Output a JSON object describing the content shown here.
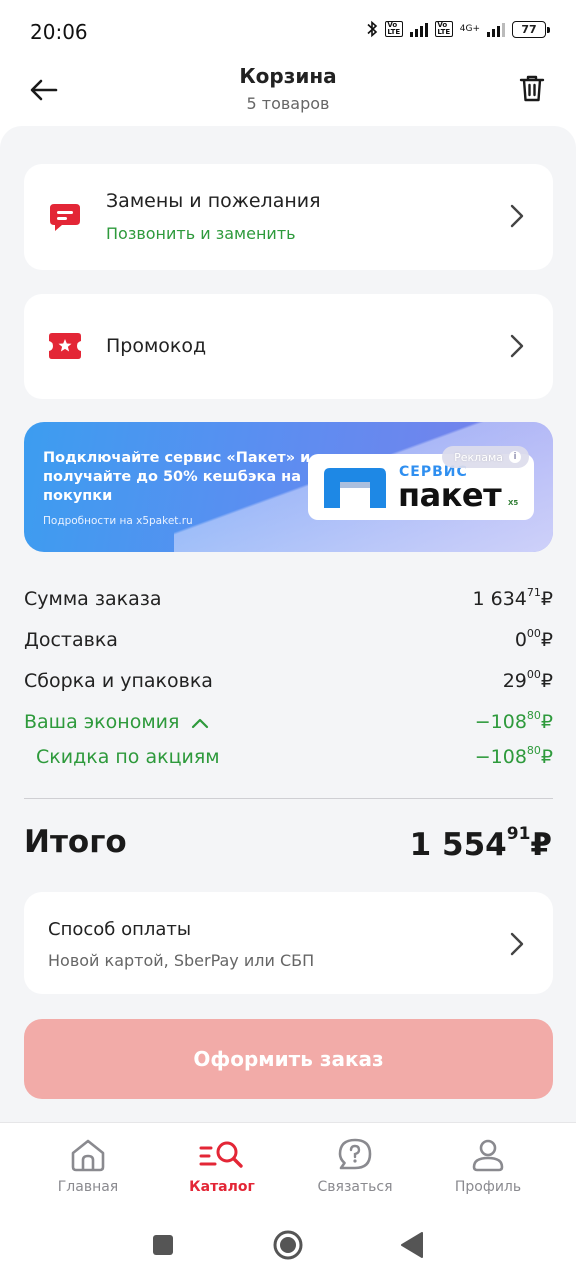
{
  "status_bar": {
    "time": "20:06",
    "network_label_1": "Vo\nLTE",
    "network_label_2": "4G+",
    "battery": "77"
  },
  "header": {
    "title": "Корзина",
    "subtitle": "5 товаров"
  },
  "replacements_card": {
    "title": "Замены и пожелания",
    "subtitle": "Позвонить и заменить",
    "icon": "chat-message-icon"
  },
  "promo_card": {
    "title": "Промокод",
    "icon": "ticket-star-icon"
  },
  "banner": {
    "text": "Подключайте сервис «Пакет» и получайте до 50% кешбэка на покупки",
    "note": "Подробности на x5paket.ru",
    "logo_top": "СЕРВИС",
    "logo_main": "пакет",
    "logo_brand": "X5",
    "ad_label": "Реклама",
    "ad_info": "i"
  },
  "summary": {
    "order_sum_label": "Сумма заказа",
    "order_sum_int": "1 634",
    "order_sum_dec": "71",
    "delivery_label": "Доставка",
    "delivery_int": "0",
    "delivery_dec": "00",
    "assembly_label": "Сборка и упаковка",
    "assembly_int": "29",
    "assembly_dec": "00",
    "savings_label": "Ваша экономия",
    "savings_int": "−108",
    "savings_dec": "80",
    "promo_discount_label": "Скидка по акциям",
    "promo_discount_int": "−108",
    "promo_discount_dec": "80",
    "currency": "₽"
  },
  "total": {
    "label": "Итого",
    "int": "1 554",
    "dec": "91",
    "currency": "₽"
  },
  "payment_card": {
    "title": "Способ оплаты",
    "subtitle": "Новой картой, SberPay или СБП"
  },
  "order_button": {
    "label": "Оформить заказ"
  },
  "bottom_nav": {
    "items": [
      {
        "label": "Главная",
        "icon": "home-icon"
      },
      {
        "label": "Каталог",
        "icon": "catalog-search-icon"
      },
      {
        "label": "Связаться",
        "icon": "help-chat-icon"
      },
      {
        "label": "Профиль",
        "icon": "profile-icon"
      }
    ],
    "active_index": 1
  },
  "colors": {
    "accent_red": "#e32636",
    "green": "#2e9a3c",
    "button_disabled": "#f2aba8",
    "background": "#f4f5f7"
  }
}
